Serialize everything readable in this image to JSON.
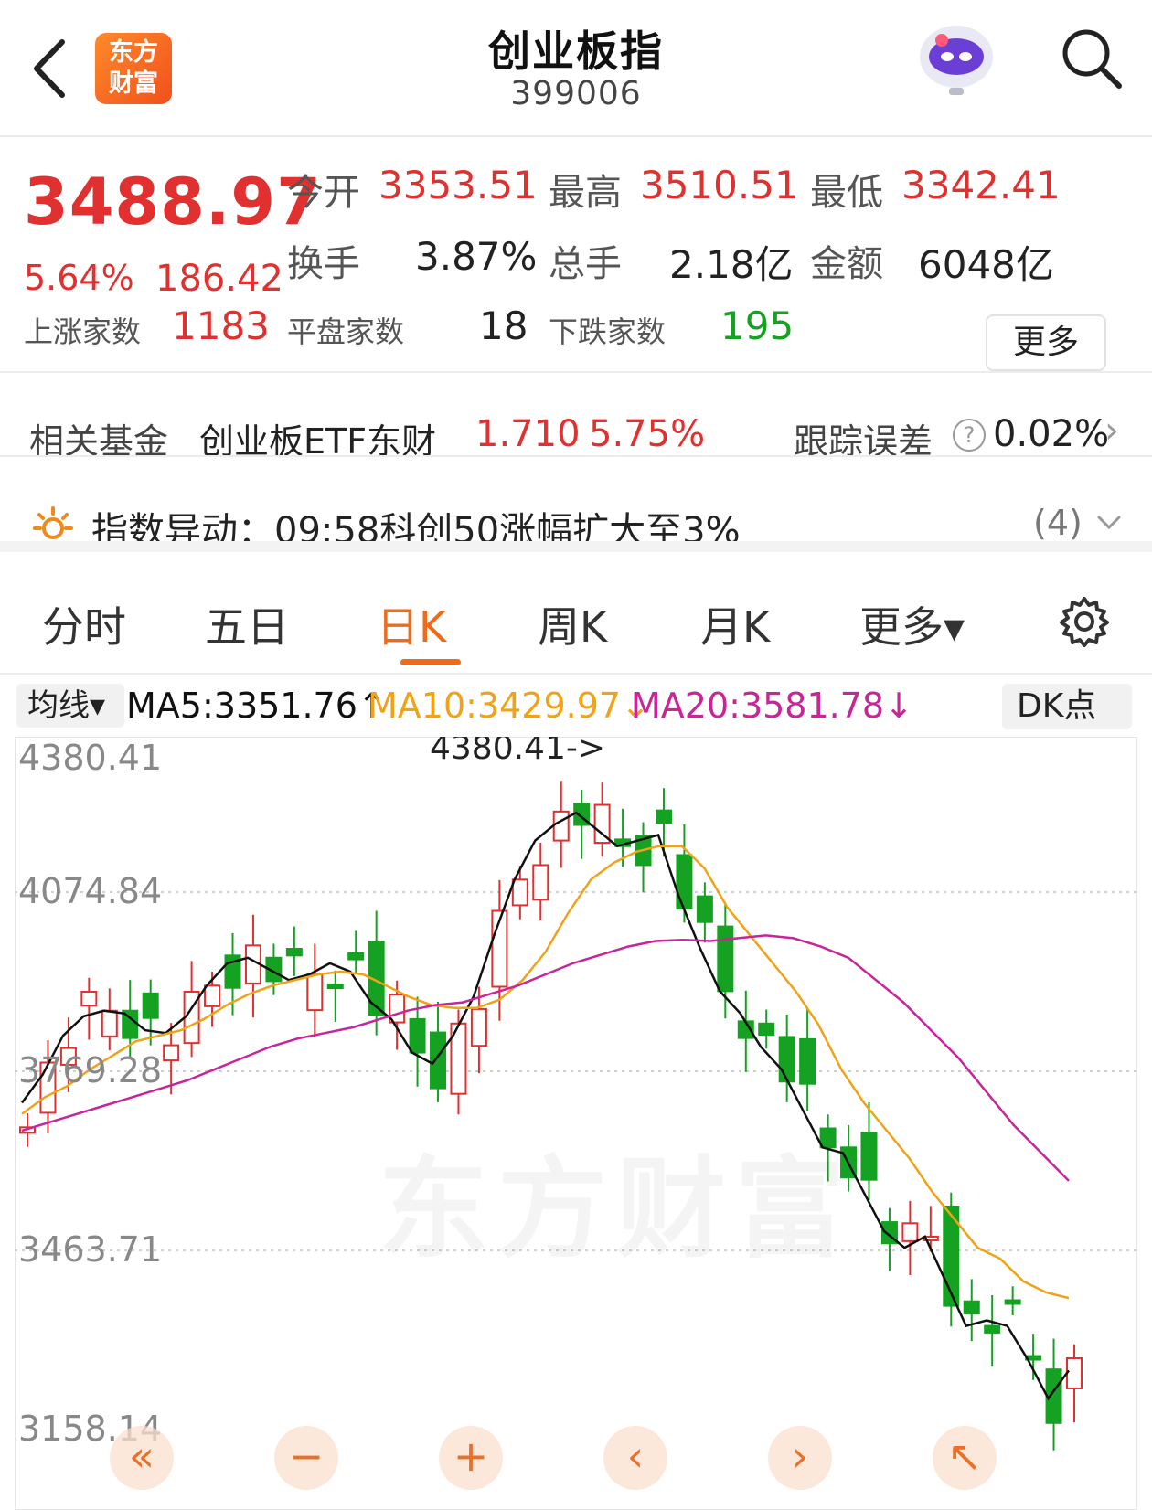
{
  "header": {
    "logo_line1": "东方",
    "logo_line2": "财富",
    "title": "创业板指",
    "code": "399006"
  },
  "quote": {
    "price": "3488.97",
    "change_pct": "5.64%",
    "change": "186.42",
    "open_label": "今开",
    "open": "3353.51",
    "high_label": "最高",
    "high": "3510.51",
    "low_label": "最低",
    "low": "3342.41",
    "turnover_label": "换手",
    "turnover": "3.87%",
    "volume_label": "总手",
    "volume": "2.18亿",
    "amount_label": "金额",
    "amount": "6048亿",
    "up_label": "上涨家数",
    "up": "1183",
    "flat_label": "平盘家数",
    "flat": "18",
    "down_label": "下跌家数",
    "down": "195",
    "more": "更多"
  },
  "fund": {
    "label": "相关基金",
    "name": "创业板ETF东财",
    "price": "1.710",
    "pct": "5.75%",
    "track_label": "跟踪误差",
    "help": "?",
    "track_value": "0.02%",
    "arrow": "›"
  },
  "alert": {
    "text": "指数异动：09:58科创50涨幅扩大至3%",
    "count": "(4)"
  },
  "tabs": [
    "分时",
    "五日",
    "日K",
    "周K",
    "月K",
    "更多▾"
  ],
  "active_tab": "日K",
  "ma": {
    "select": "均线▾",
    "ma5": "MA5:3351.76↑",
    "ma10": "MA10:3429.97↓",
    "ma20": "MA20:3581.78↓",
    "dk": "DK点"
  },
  "watermark": "东方财富",
  "colors": {
    "up": "#e0302f",
    "down": "#15a121",
    "ma5": "#111111",
    "ma10": "#f0a318",
    "ma20": "#c8259a",
    "accent": "#ee6b1c"
  },
  "controls": [
    "«",
    "−",
    "+",
    "‹",
    "›",
    "↖"
  ],
  "chart_data": {
    "type": "candlestick",
    "y_ticks": [
      "4380.41",
      "4074.84",
      "3769.28",
      "3463.71",
      "3158.14"
    ],
    "ylim": [
      3158.14,
      4380.41
    ],
    "max_annotation": "4380.41->",
    "series": [
      {
        "name": "MA5",
        "values": [
          3780,
          3830,
          3900,
          3935,
          3945,
          3940,
          3910,
          3905,
          3935,
          3990,
          4030,
          4040,
          4020,
          4000,
          4010,
          4030,
          4015,
          3960,
          3930,
          3870,
          3850,
          3900,
          3970,
          4080,
          4180,
          4250,
          4280,
          4300,
          4270,
          4240,
          4250,
          4260,
          4150,
          4060,
          3980,
          3940,
          3880,
          3840,
          3770,
          3700,
          3690,
          3620,
          3550,
          3520,
          3540,
          3460,
          3380,
          3390,
          3380,
          3320,
          3250,
          3300
        ]
      },
      {
        "name": "MA10",
        "values": [
          3760,
          3790,
          3810,
          3840,
          3865,
          3890,
          3900,
          3910,
          3930,
          3955,
          3975,
          3990,
          4000,
          4010,
          4015,
          4010,
          3990,
          3970,
          3955,
          3950,
          3950,
          3965,
          4000,
          4050,
          4120,
          4180,
          4210,
          4230,
          4240,
          4240,
          4200,
          4130,
          4080,
          4030,
          3980,
          3920,
          3840,
          3780,
          3730,
          3680,
          3620,
          3570,
          3520,
          3500,
          3460,
          3440,
          3430
        ]
      },
      {
        "name": "MA20",
        "values": [
          3730,
          3745,
          3760,
          3775,
          3790,
          3805,
          3820,
          3840,
          3860,
          3880,
          3895,
          3905,
          3915,
          3930,
          3945,
          3955,
          3960,
          3975,
          3990,
          4010,
          4030,
          4045,
          4060,
          4070,
          4072,
          4070,
          4075,
          4080,
          4075,
          4060,
          4040,
          4000,
          3960,
          3910,
          3860,
          3800,
          3740,
          3690,
          3640
        ]
      }
    ]
  }
}
